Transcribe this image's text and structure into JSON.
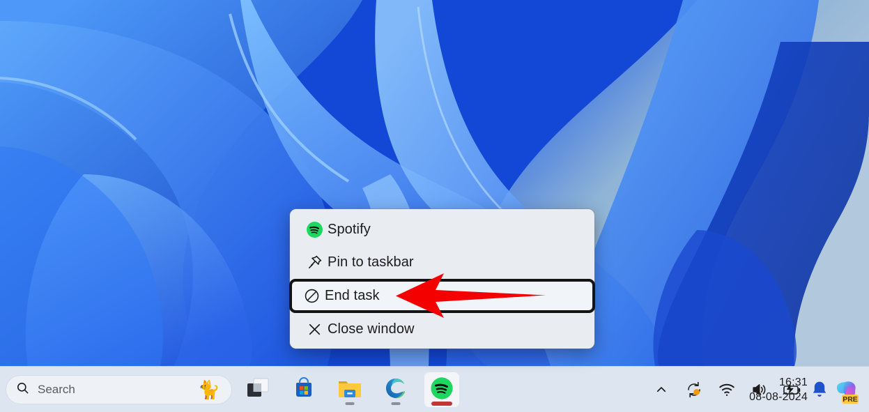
{
  "desktop": {
    "wallpaper_name": "windows-11-bloom-wallpaper",
    "wallpaper_colors": [
      "#0a3bd0",
      "#1a56e8",
      "#3b82f6",
      "#5aa6fb",
      "#a8c3dc"
    ]
  },
  "context_menu": {
    "name": "spotify-taskbar-jumplist",
    "items": [
      {
        "label": "Spotify",
        "icon": "spotify-icon",
        "highlighted": false
      },
      {
        "label": "Pin to taskbar",
        "icon": "pin-icon",
        "highlighted": false
      },
      {
        "label": "End task",
        "icon": "end-task-icon",
        "highlighted": true
      },
      {
        "label": "Close window",
        "icon": "close-window-icon",
        "highlighted": false
      }
    ]
  },
  "annotation": {
    "arrow_color": "#f50000",
    "points_to": "End task",
    "direction": "left"
  },
  "taskbar": {
    "search": {
      "placeholder": "Search",
      "value": "",
      "icon": "search-icon",
      "badge_icon": "cat-emoji",
      "badge_glyph": "🐈"
    },
    "apps": [
      {
        "name": "task-view",
        "label": "Task view",
        "running": false,
        "active": false
      },
      {
        "name": "microsoft-store",
        "label": "Microsoft Store",
        "running": false,
        "active": false
      },
      {
        "name": "file-explorer",
        "label": "File Explorer",
        "running": true,
        "active": false
      },
      {
        "name": "microsoft-edge",
        "label": "Microsoft Edge",
        "running": true,
        "active": false
      },
      {
        "name": "spotify",
        "label": "Spotify",
        "running": true,
        "active": true
      }
    ],
    "tray": [
      {
        "name": "show-hidden-icons",
        "label": "Show hidden icons"
      },
      {
        "name": "windows-update",
        "label": "Windows Update available",
        "badge": "#f59b0b"
      },
      {
        "name": "network-wifi",
        "label": "Network / Wi-Fi"
      },
      {
        "name": "volume",
        "label": "Volume"
      },
      {
        "name": "battery-charging",
        "label": "Battery charging"
      }
    ],
    "clock": {
      "time": "16:31",
      "date": "08-08-2024"
    },
    "notifications": {
      "name": "notification-bell",
      "label": "Notifications",
      "color": "#1e52c8"
    },
    "copilot": {
      "name": "copilot",
      "label": "Copilot",
      "badge_text": "PRE"
    }
  }
}
